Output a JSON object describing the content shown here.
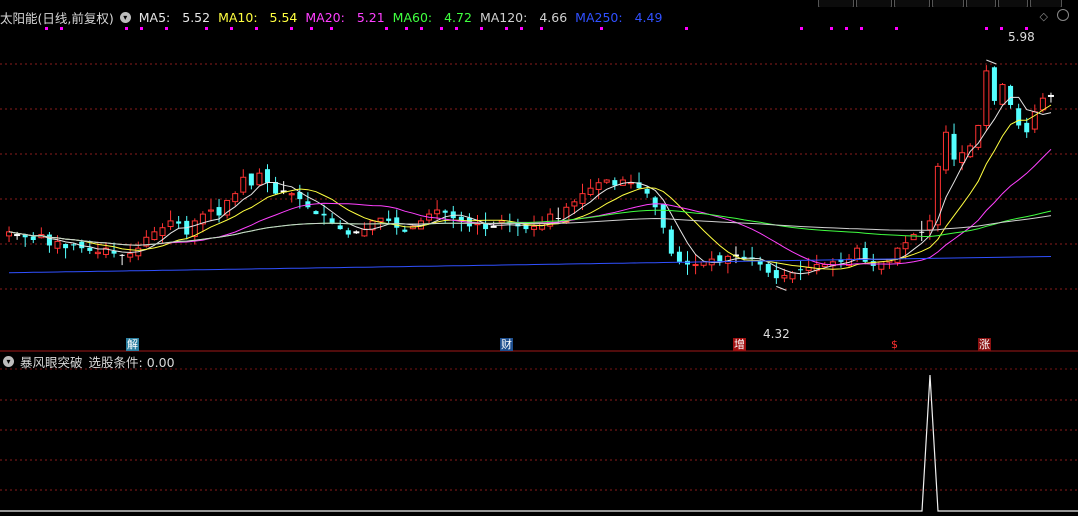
{
  "stock": {
    "name": "太阳能",
    "mode": "(日线,前复权)"
  },
  "ma_legend": [
    {
      "label": "MA5:",
      "value": "5.52",
      "color": "#e6e6e6"
    },
    {
      "label": "MA10:",
      "value": "5.54",
      "color": "#ffff40"
    },
    {
      "label": "MA20:",
      "value": "5.21",
      "color": "#ff40ff"
    },
    {
      "label": "MA60:",
      "value": "4.72",
      "color": "#40ff40"
    },
    {
      "label": "MA120:",
      "value": "4.66",
      "color": "#d0d0d0"
    },
    {
      "label": "MA250:",
      "value": "4.49",
      "color": "#3050ff"
    }
  ],
  "indicator": {
    "name": "暴风眼突破",
    "condition_label": "选股条件:",
    "condition_value": "0.00"
  },
  "annotations": {
    "high": "5.98",
    "low": "4.32"
  },
  "events": [
    {
      "char": "解",
      "bg": "#2b7fa0",
      "color": "#fff"
    },
    {
      "char": "财",
      "bg": "#1e4f8f",
      "color": "#fff"
    },
    {
      "char": "增",
      "bg": "#a01010",
      "color": "#fff"
    },
    {
      "char": "$",
      "bg": "transparent",
      "color": "#ff3030"
    },
    {
      "char": "涨",
      "bg": "#8a1010",
      "color": "#fff"
    }
  ],
  "colors": {
    "up": "#ff3232",
    "down": "#54ffff",
    "flat": "#ffffff",
    "grid": "#8a1c1c",
    "signal_dots": "#ff00ff"
  },
  "icons": [
    "collapse-circle-icon",
    "diamond-icon",
    "settings-circle-icon"
  ],
  "chart_data": {
    "type": "candlestick",
    "title": "太阳能 日线 前复权",
    "y_range": [
      4.0,
      6.2
    ],
    "high_value": 5.98,
    "low_value": 4.32,
    "close": [
      4.72,
      4.7,
      4.68,
      4.66,
      4.7,
      4.62,
      4.65,
      4.6,
      4.62,
      4.6,
      4.58,
      4.57,
      4.6,
      4.56,
      4.55,
      4.56,
      4.6,
      4.68,
      4.72,
      4.75,
      4.8,
      4.78,
      4.7,
      4.8,
      4.85,
      4.88,
      4.84,
      4.95,
      5.0,
      5.12,
      5.06,
      5.15,
      5.08,
      5.0,
      5.02,
      5.0,
      4.96,
      4.9,
      4.85,
      4.84,
      4.78,
      4.74,
      4.7,
      4.72,
      4.74,
      4.8,
      4.82,
      4.8,
      4.75,
      4.72,
      4.76,
      4.8,
      4.85,
      4.88,
      4.86,
      4.82,
      4.8,
      4.76,
      4.78,
      4.74,
      4.76,
      4.8,
      4.78,
      4.76,
      4.74,
      4.76,
      4.78,
      4.85,
      4.82,
      4.9,
      4.94,
      5.0,
      5.04,
      5.08,
      5.1,
      5.06,
      5.1,
      5.08,
      5.04,
      5.0,
      4.9,
      4.75,
      4.56,
      4.5,
      4.48,
      4.48,
      4.5,
      4.52,
      4.5,
      4.54,
      4.55,
      4.52,
      4.52,
      4.48,
      4.42,
      4.38,
      4.4,
      4.42,
      4.44,
      4.46,
      4.48,
      4.48,
      4.5,
      4.5,
      4.52,
      4.6,
      4.5,
      4.47,
      4.5,
      4.52,
      4.6,
      4.64,
      4.7,
      4.72,
      4.8,
      5.2,
      5.45,
      5.25,
      5.3,
      5.35,
      5.5,
      5.9,
      5.68,
      5.8,
      5.65,
      5.5,
      5.45,
      5.6,
      5.7,
      5.72
    ]
  }
}
